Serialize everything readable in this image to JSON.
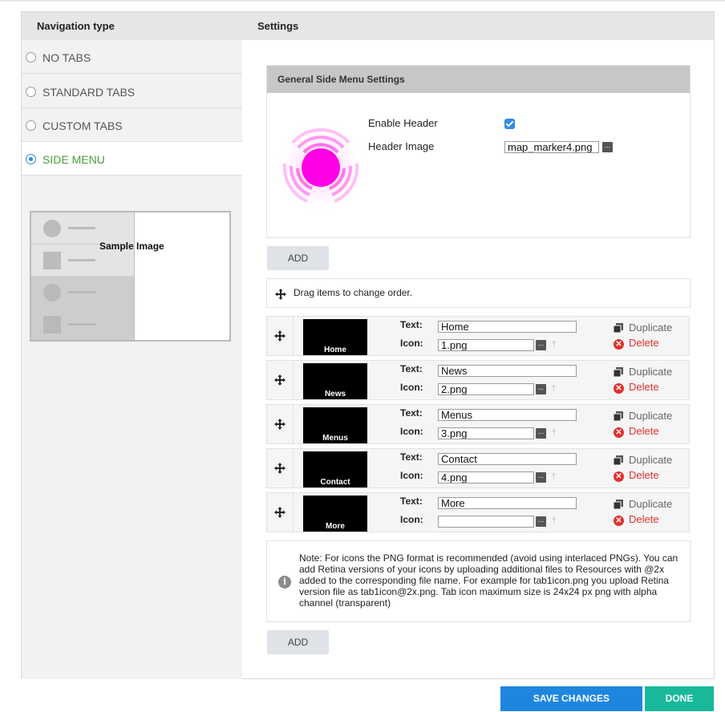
{
  "header": {
    "nav_type_label": "Navigation type",
    "settings_label": "Settings"
  },
  "nav_options": [
    {
      "label": "NO TABS",
      "selected": false
    },
    {
      "label": "STANDARD TABS",
      "selected": false
    },
    {
      "label": "CUSTOM TABS",
      "selected": false
    },
    {
      "label": "SIDE MENU",
      "selected": true
    }
  ],
  "sample": {
    "label": "Sample Image"
  },
  "general": {
    "title": "General Side Menu Settings",
    "enable_header_label": "Enable Header",
    "enable_header_checked": true,
    "header_image_label": "Header Image",
    "header_image_value": "map_marker4.png",
    "browse_glyph": "..."
  },
  "add_label": "ADD",
  "drag_hint": "Drag items to change order.",
  "items_labels": {
    "text_label": "Text:",
    "icon_label": "Icon:",
    "duplicate": "Duplicate",
    "delete": "Delete"
  },
  "menu_items": [
    {
      "thumb": "Home",
      "text": "Home",
      "icon": "1.png"
    },
    {
      "thumb": "News",
      "text": "News",
      "icon": "2.png"
    },
    {
      "thumb": "Menus",
      "text": "Menus",
      "icon": "3.png"
    },
    {
      "thumb": "Contact",
      "text": "Contact",
      "icon": "4.png"
    },
    {
      "thumb": "More",
      "text": "More",
      "icon": ""
    }
  ],
  "note": "Note: For icons the PNG format is recommended (avoid using interlaced PNGs). You can add Retina versions of your icons by uploading additional files to Resources with @2x added to the corresponding file name. For example for tab1icon.png you upload Retina version file as tab1icon@2x.png. Tab icon maximum size is 24x24 px png with alpha channel (transparent)",
  "footer": {
    "save_label": "SAVE CHANGES",
    "done_label": "DONE"
  },
  "colors": {
    "accent": "#1f86e0",
    "done": "#19b89a",
    "active_nav": "#4a9a3a",
    "delete": "#e0302d",
    "marker": "#ff00e6"
  }
}
